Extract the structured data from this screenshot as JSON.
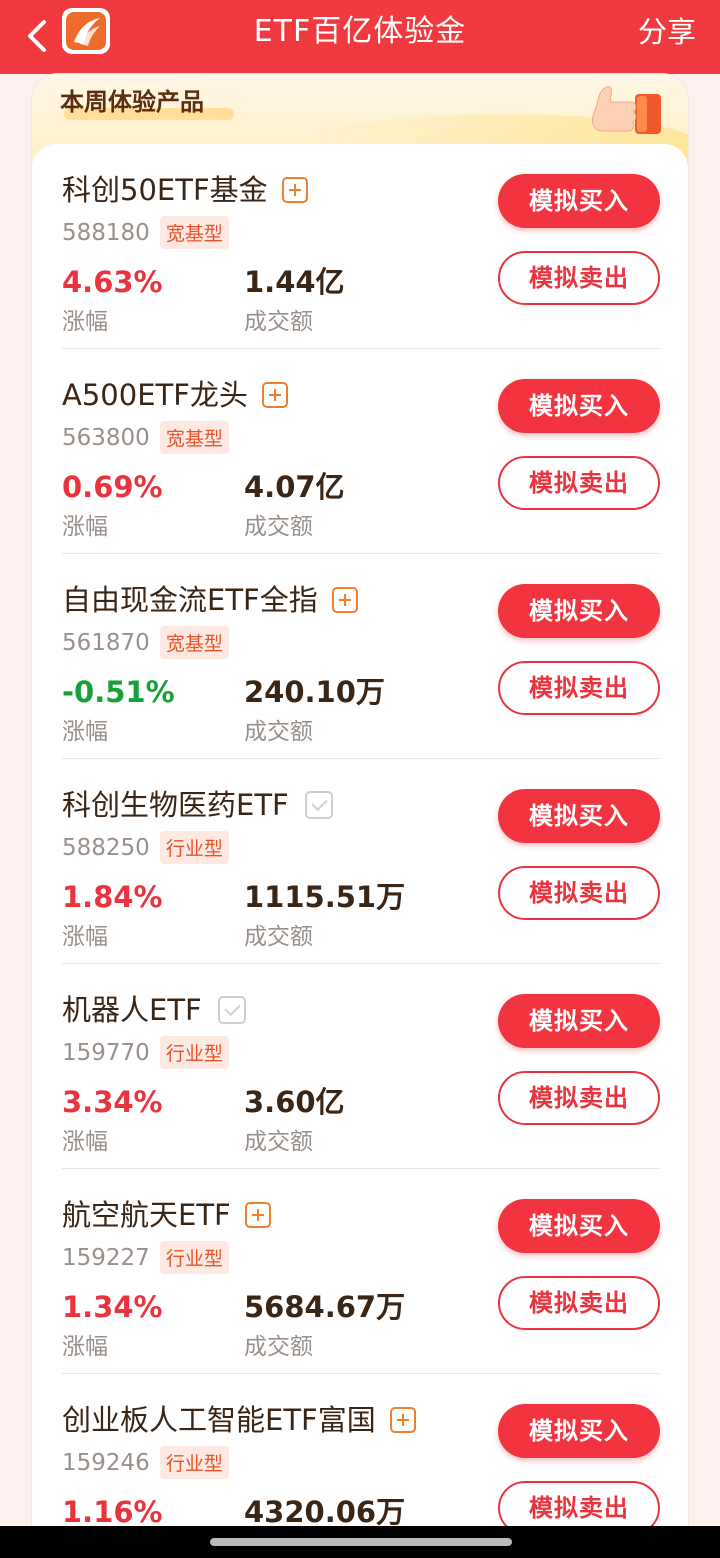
{
  "header": {
    "title": "ETF百亿体验金",
    "share_label": "分享",
    "accent_color": "#f03a3f"
  },
  "section": {
    "title": "本周体验产品"
  },
  "labels": {
    "change": "涨幅",
    "volume": "成交额",
    "buy": "模拟买入",
    "sell": "模拟卖出"
  },
  "products": [
    {
      "name": "科创50ETF基金",
      "code": "588180",
      "type": "宽基型",
      "change": "4.63%",
      "trend": "up",
      "volume": "1.44亿",
      "added": false
    },
    {
      "name": "A500ETF龙头",
      "code": "563800",
      "type": "宽基型",
      "change": "0.69%",
      "trend": "up",
      "volume": "4.07亿",
      "added": false
    },
    {
      "name": "自由现金流ETF全指",
      "code": "561870",
      "type": "宽基型",
      "change": "-0.51%",
      "trend": "down",
      "volume": "240.10万",
      "added": false
    },
    {
      "name": "科创生物医药ETF",
      "code": "588250",
      "type": "行业型",
      "change": "1.84%",
      "trend": "up",
      "volume": "1115.51万",
      "added": true
    },
    {
      "name": "机器人ETF",
      "code": "159770",
      "type": "行业型",
      "change": "3.34%",
      "trend": "up",
      "volume": "3.60亿",
      "added": true
    },
    {
      "name": "航空航天ETF",
      "code": "159227",
      "type": "行业型",
      "change": "1.34%",
      "trend": "up",
      "volume": "5684.67万",
      "added": false
    },
    {
      "name": "创业板人工智能ETF富国",
      "code": "159246",
      "type": "行业型",
      "change": "1.16%",
      "trend": "up",
      "volume": "4320.06万",
      "added": false
    }
  ]
}
